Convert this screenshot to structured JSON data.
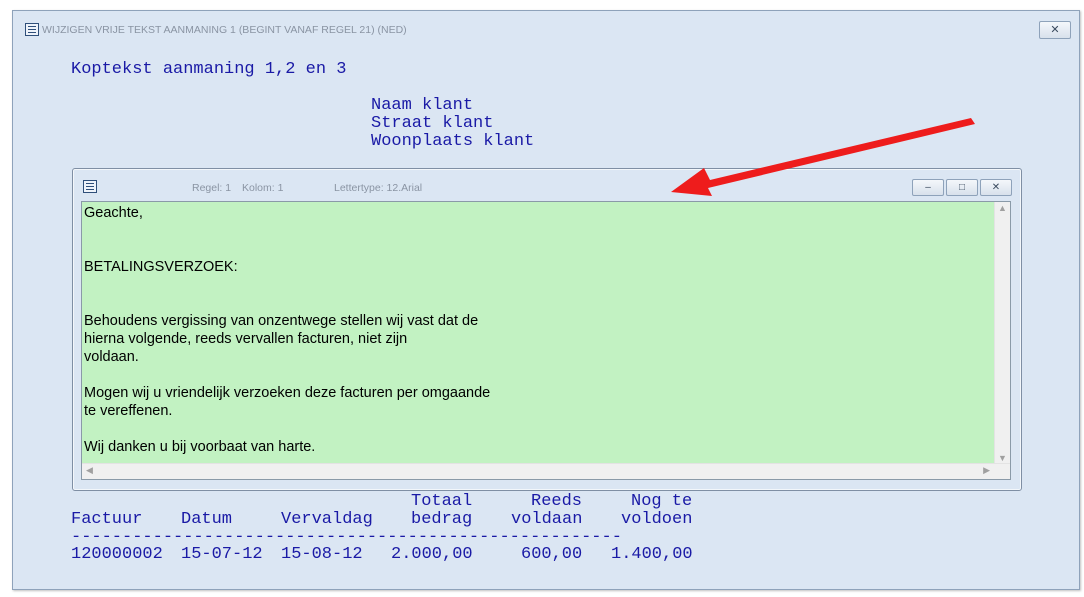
{
  "window": {
    "title": "WIJZIGEN VRIJE TEKST AANMANING 1  (BEGINT VANAF REGEL 21) (NED)",
    "close_glyph": "✕"
  },
  "header": {
    "kopt_label": "Koptekst aanmaning 1,2 en 3",
    "address_lines": [
      "Naam klant",
      "Straat klant",
      "Woonplaats klant"
    ]
  },
  "editor_window": {
    "status": {
      "regel": "Regel: 1",
      "kolom": "Kolom: 1",
      "lettertype": "Lettertype: 12.Arial"
    },
    "buttons": {
      "minimize": "–",
      "restore": "□",
      "close": "✕"
    },
    "text": "Geachte,\n\n\nBETALINGSVERZOEK:\n\n\nBehoudens vergissing van onzentwege stellen wij vast dat de\nhierna volgende, reeds vervallen facturen, niet zijn\nvoldaan.\n\nMogen wij u vriendelijk verzoeken deze facturen per omgaande\nte vereffenen.\n\nWij danken u bij voorbaat van harte."
  },
  "table": {
    "headers_top": [
      "",
      "",
      "",
      "Totaal",
      "Reeds",
      "Nog te"
    ],
    "headers_bottom": [
      "Factuur",
      "Datum",
      "Vervaldag",
      "bedrag",
      "voldaan",
      "voldoen"
    ],
    "separator": "------------------------------------------------------",
    "row": [
      "120000002",
      "15-07-12",
      "15-08-12",
      "2.000,00",
      "600,00",
      "1.400,00"
    ]
  },
  "annotation": {
    "arrow_color": "#ee1c1c"
  }
}
